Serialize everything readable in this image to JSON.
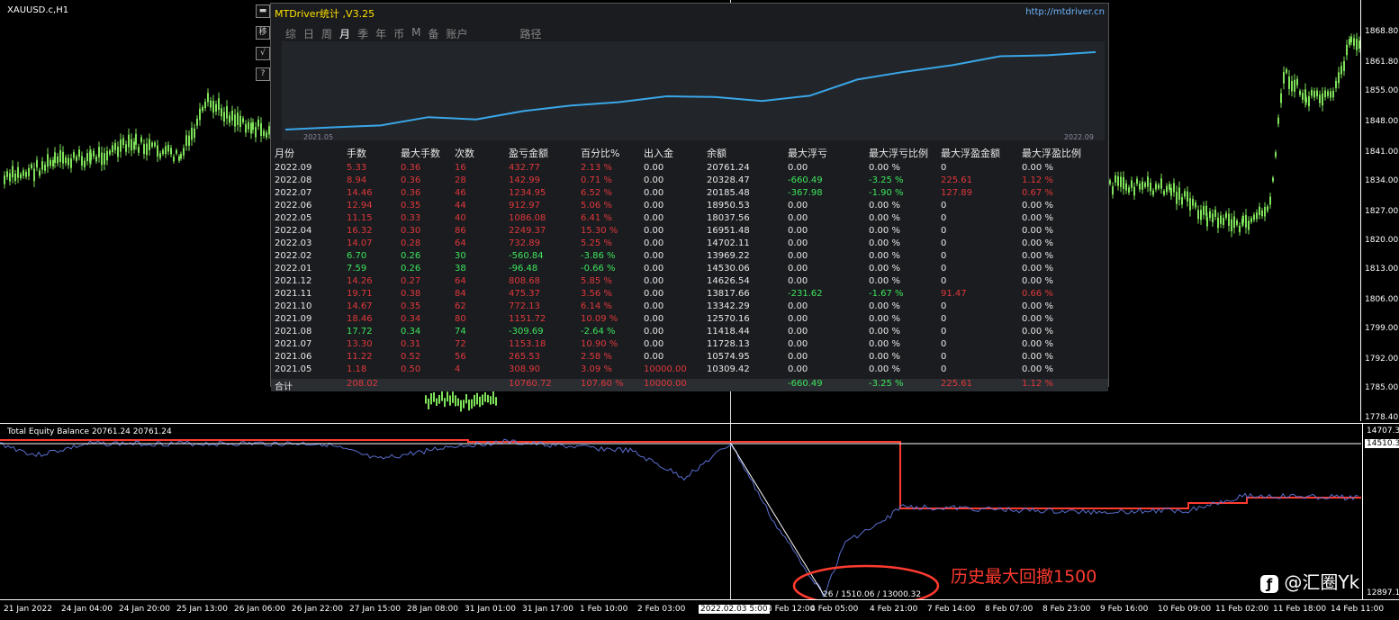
{
  "main": {
    "symbol": "XAUUSD.c,H1",
    "price_ticks": [
      "1868.80",
      "1861.80",
      "1855.00",
      "1848.00",
      "1841.00",
      "1834.00",
      "1827.00",
      "1820.00",
      "1813.00",
      "1806.00",
      "1799.00",
      "1792.00",
      "1785.00",
      "1778.40"
    ]
  },
  "side_buttons": [
    "移",
    "√",
    "?"
  ],
  "panel": {
    "title": "MTDriver统计 ,V3.25",
    "link": "http://mtdriver.cn",
    "tabs": [
      "综",
      "日",
      "周",
      "月",
      "季",
      "年",
      "币",
      "M",
      "备",
      "账户",
      "路径"
    ],
    "active_tab": "月",
    "eq_start_label": "2021.05",
    "eq_end_label": "2022.09",
    "headers": [
      "月份",
      "手数",
      "最大手数",
      "次数",
      "盈亏金额",
      "百分比%",
      "出入金",
      "余额",
      "最大浮亏",
      "最大浮亏比例",
      "最大浮盈金额",
      "最大浮盈比例"
    ],
    "rows": [
      {
        "m": "2022.09",
        "lots": "5.33",
        "maxlot": "0.36",
        "n": "16",
        "pl": "432.77",
        "pct": "2.13 %",
        "io": "0.00",
        "bal": "20761.24",
        "mfl": "0.00",
        "mflp": "0.00 %",
        "mfp": "0",
        "mfpp": "0.00 %",
        "c": "red"
      },
      {
        "m": "2022.08",
        "lots": "8.94",
        "maxlot": "0.36",
        "n": "28",
        "pl": "142.99",
        "pct": "0.71 %",
        "io": "0.00",
        "bal": "20328.47",
        "mfl": "-660.49",
        "mflp": "-3.25 %",
        "mfp": "225.61",
        "mfpp": "1.12 %",
        "c": "red"
      },
      {
        "m": "2022.07",
        "lots": "14.46",
        "maxlot": "0.36",
        "n": "46",
        "pl": "1234.95",
        "pct": "6.52 %",
        "io": "0.00",
        "bal": "20185.48",
        "mfl": "-367.98",
        "mflp": "-1.90 %",
        "mfp": "127.89",
        "mfpp": "0.67 %",
        "c": "red"
      },
      {
        "m": "2022.06",
        "lots": "12.94",
        "maxlot": "0.35",
        "n": "44",
        "pl": "912.97",
        "pct": "5.06 %",
        "io": "0.00",
        "bal": "18950.53",
        "mfl": "0.00",
        "mflp": "0.00 %",
        "mfp": "0",
        "mfpp": "0.00 %",
        "c": "red"
      },
      {
        "m": "2022.05",
        "lots": "11.15",
        "maxlot": "0.33",
        "n": "40",
        "pl": "1086.08",
        "pct": "6.41 %",
        "io": "0.00",
        "bal": "18037.56",
        "mfl": "0.00",
        "mflp": "0.00 %",
        "mfp": "0",
        "mfpp": "0.00 %",
        "c": "red"
      },
      {
        "m": "2022.04",
        "lots": "16.32",
        "maxlot": "0.30",
        "n": "86",
        "pl": "2249.37",
        "pct": "15.30 %",
        "io": "0.00",
        "bal": "16951.48",
        "mfl": "0.00",
        "mflp": "0.00 %",
        "mfp": "0",
        "mfpp": "0.00 %",
        "c": "red"
      },
      {
        "m": "2022.03",
        "lots": "14.07",
        "maxlot": "0.28",
        "n": "64",
        "pl": "732.89",
        "pct": "5.25 %",
        "io": "0.00",
        "bal": "14702.11",
        "mfl": "0.00",
        "mflp": "0.00 %",
        "mfp": "0",
        "mfpp": "0.00 %",
        "c": "red"
      },
      {
        "m": "2022.02",
        "lots": "6.70",
        "maxlot": "0.26",
        "n": "30",
        "pl": "-560.84",
        "pct": "-3.86 %",
        "io": "0.00",
        "bal": "13969.22",
        "mfl": "0.00",
        "mflp": "0.00 %",
        "mfp": "0",
        "mfpp": "0.00 %",
        "c": "grn"
      },
      {
        "m": "2022.01",
        "lots": "7.59",
        "maxlot": "0.26",
        "n": "38",
        "pl": "-96.48",
        "pct": "-0.66 %",
        "io": "0.00",
        "bal": "14530.06",
        "mfl": "0.00",
        "mflp": "0.00 %",
        "mfp": "0",
        "mfpp": "0.00 %",
        "c": "grn"
      },
      {
        "m": "2021.12",
        "lots": "14.26",
        "maxlot": "0.27",
        "n": "64",
        "pl": "808.68",
        "pct": "5.85 %",
        "io": "0.00",
        "bal": "14626.54",
        "mfl": "0.00",
        "mflp": "0.00 %",
        "mfp": "0",
        "mfpp": "0.00 %",
        "c": "red"
      },
      {
        "m": "2021.11",
        "lots": "19.71",
        "maxlot": "0.38",
        "n": "84",
        "pl": "475.37",
        "pct": "3.56 %",
        "io": "0.00",
        "bal": "13817.66",
        "mfl": "-231.62",
        "mflp": "-1.67 %",
        "mfp": "91.47",
        "mfpp": "0.66 %",
        "c": "red"
      },
      {
        "m": "2021.10",
        "lots": "14.67",
        "maxlot": "0.35",
        "n": "62",
        "pl": "772.13",
        "pct": "6.14 %",
        "io": "0.00",
        "bal": "13342.29",
        "mfl": "0.00",
        "mflp": "0.00 %",
        "mfp": "0",
        "mfpp": "0.00 %",
        "c": "red"
      },
      {
        "m": "2021.09",
        "lots": "18.46",
        "maxlot": "0.34",
        "n": "80",
        "pl": "1151.72",
        "pct": "10.09 %",
        "io": "0.00",
        "bal": "12570.16",
        "mfl": "0.00",
        "mflp": "0.00 %",
        "mfp": "0",
        "mfpp": "0.00 %",
        "c": "red"
      },
      {
        "m": "2021.08",
        "lots": "17.72",
        "maxlot": "0.34",
        "n": "74",
        "pl": "-309.69",
        "pct": "-2.64 %",
        "io": "0.00",
        "bal": "11418.44",
        "mfl": "0.00",
        "mflp": "0.00 %",
        "mfp": "0",
        "mfpp": "0.00 %",
        "c": "grn"
      },
      {
        "m": "2021.07",
        "lots": "13.30",
        "maxlot": "0.31",
        "n": "72",
        "pl": "1153.18",
        "pct": "10.90 %",
        "io": "0.00",
        "bal": "11728.13",
        "mfl": "0.00",
        "mflp": "0.00 %",
        "mfp": "0",
        "mfpp": "0.00 %",
        "c": "red"
      },
      {
        "m": "2021.06",
        "lots": "11.22",
        "maxlot": "0.52",
        "n": "56",
        "pl": "265.53",
        "pct": "2.58 %",
        "io": "0.00",
        "bal": "10574.95",
        "mfl": "0.00",
        "mflp": "0.00 %",
        "mfp": "0",
        "mfpp": "0.00 %",
        "c": "red"
      },
      {
        "m": "2021.05",
        "lots": "1.18",
        "maxlot": "0.50",
        "n": "4",
        "pl": "308.90",
        "pct": "3.09 %",
        "io": "10000.00",
        "bal": "10309.42",
        "mfl": "0.00",
        "mflp": "0.00 %",
        "mfp": "0",
        "mfpp": "0.00 %",
        "c": "red"
      }
    ],
    "total": {
      "label": "合计",
      "lots": "208.02",
      "pl": "10760.72",
      "pct": "107.60 %",
      "io": "10000.00",
      "mfl": "-660.49",
      "mflp": "-3.25 %",
      "mfp": "225.61",
      "mfpp": "1.12 %"
    }
  },
  "subwindow": {
    "label": "Total Equity Balance 20761.24 20761.24",
    "tick_top": "14707.34",
    "tick_mark": "14510.3",
    "tick_bottom": "12897.15"
  },
  "xaxis": [
    {
      "t": "21 Jan 2022"
    },
    {
      "t": "24 Jan 04:00"
    },
    {
      "t": "24 Jan 20:00"
    },
    {
      "t": "25 Jan 13:00"
    },
    {
      "t": "26 Jan 06:00"
    },
    {
      "t": "26 Jan 22:00"
    },
    {
      "t": "27 Jan 15:00"
    },
    {
      "t": "28 Jan 08:00"
    },
    {
      "t": "31 Jan 01:00"
    },
    {
      "t": "31 Jan 17:00"
    },
    {
      "t": "1 Feb 10:00"
    },
    {
      "t": "2 Feb 03:00"
    },
    {
      "t": "2022.02.03 5:00"
    },
    {
      "t": "3 Feb 12:00"
    },
    {
      "t": "4 Feb 05:00"
    },
    {
      "t": "4 Feb 21:00"
    },
    {
      "t": "7 Feb 14:00"
    },
    {
      "t": "8 Feb 07:00"
    },
    {
      "t": "8 Feb 23:00"
    },
    {
      "t": "9 Feb 16:00"
    },
    {
      "t": "10 Feb 09:00"
    },
    {
      "t": "11 Feb 02:00"
    },
    {
      "t": "11 Feb 18:00"
    },
    {
      "t": "14 Feb 11:00"
    }
  ],
  "annotation": {
    "text": "历史最大回撤1500",
    "measure": "26 / 1510.06 / 13000.32",
    "color": "#ff3b30"
  },
  "watermark": "@汇圈Yk"
}
